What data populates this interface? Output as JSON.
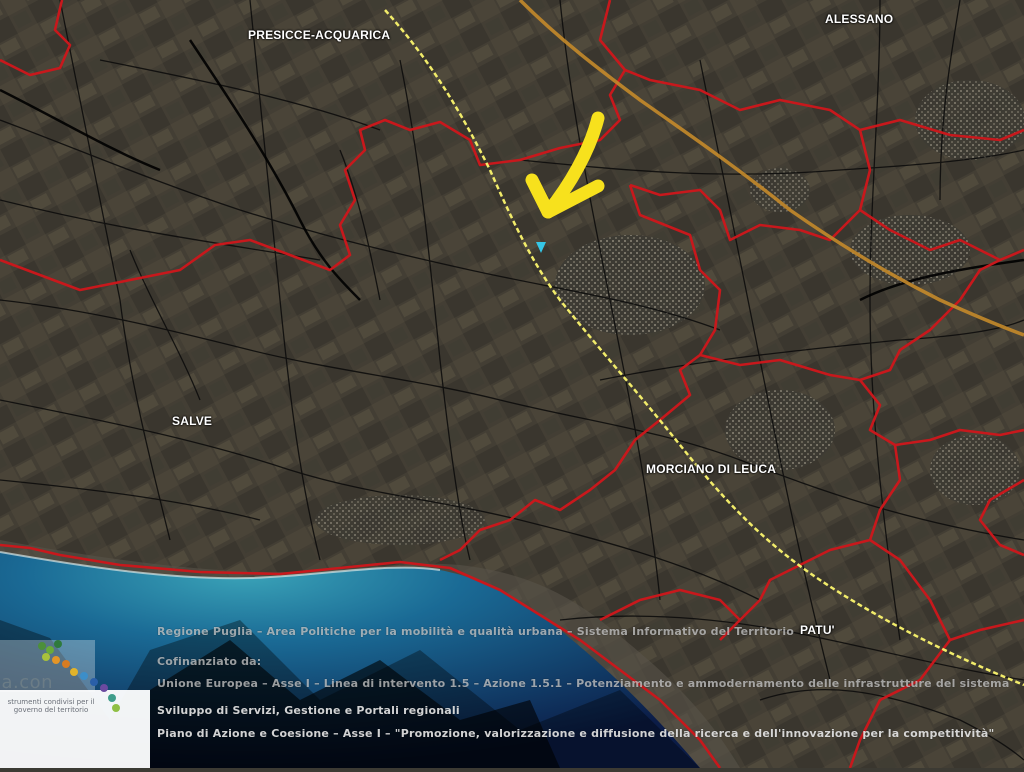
{
  "map": {
    "towns": [
      {
        "name": "PRESICCE-ACQUARICA"
      },
      {
        "name": "ALESSANO"
      },
      {
        "name": "SALVE"
      },
      {
        "name": "MORCIANO DI LEUCA"
      },
      {
        "name": "PATU'"
      }
    ],
    "colors": {
      "terrain": "#4a463c",
      "sea_light": "#2f8ea8",
      "sea_dark": "#0c1f4a",
      "boundary": "#c8181c",
      "railway": "#f2ec6a",
      "highway": "#c4892a",
      "roads": "#0a0a0a",
      "arrow": "#f7e11d",
      "marker": "#35c6e6"
    },
    "icons": [
      "location-arrow-icon",
      "map-marker-icon",
      "regione-logo-icon"
    ]
  },
  "watermark": {
    "line1": "Regione Puglia – Area Politiche per la mobilità e qualità urbana – Sistema Informativo del Territorio",
    "line2": "Cofinanziato da:",
    "line3": "Unione Europea – Asse I – Linea di intervento 1.5 – Azione 1.5.1 – Potenziamento e ammodernamento delle infrastrutture del sistema",
    "line4": "Sviluppo di Servizi, Gestione e Portali regionali",
    "line5": "Piano di Azione e Coesione – Asse I – \"Promozione, valorizzazione e diffusione della ricerca e dell'innovazione per la competitività\""
  },
  "logo": {
    "word": "ia.con",
    "caption": "strumenti condivisi per il governo del territorio"
  }
}
